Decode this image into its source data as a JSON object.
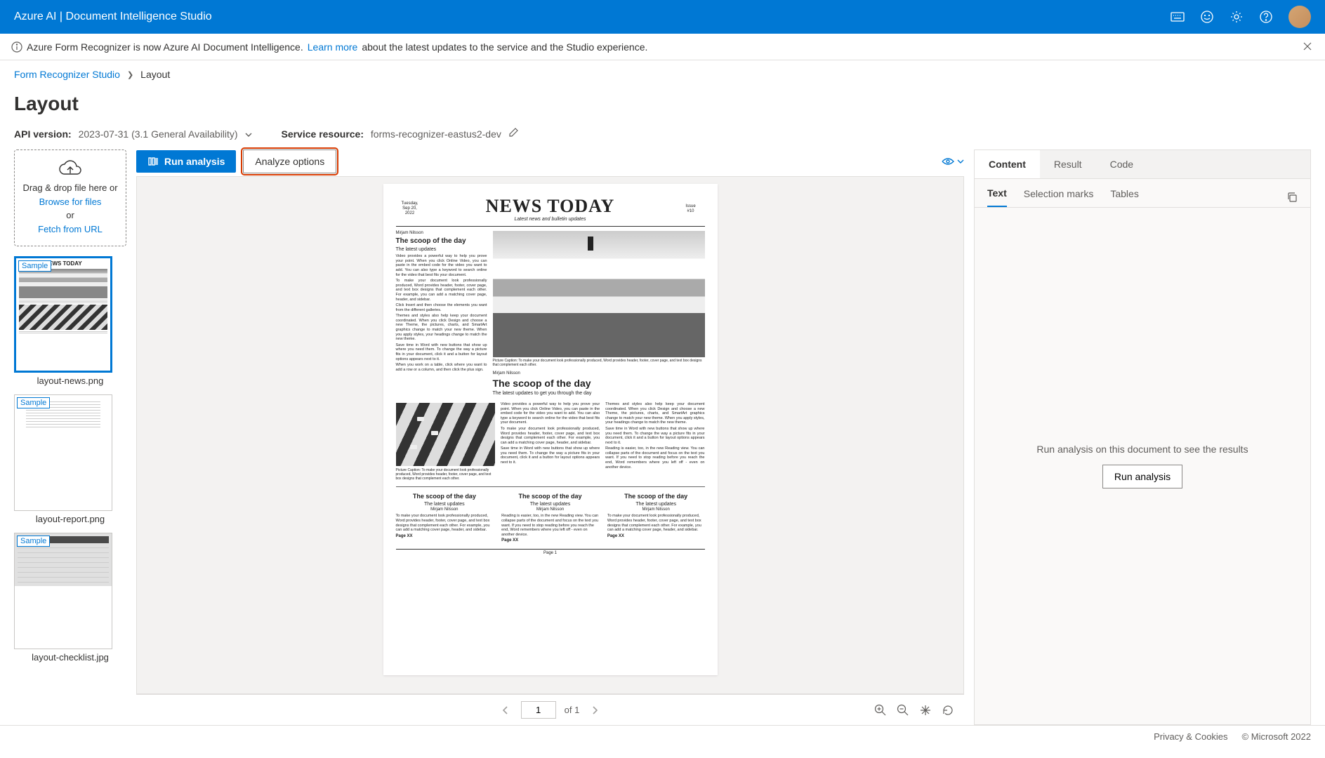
{
  "header": {
    "app_title": "Azure AI | Document Intelligence Studio"
  },
  "banner": {
    "prefix": "Azure Form Recognizer is now Azure AI Document Intelligence. ",
    "link": "Learn more",
    "suffix": " about the latest updates to the service and the Studio experience."
  },
  "breadcrumb": {
    "parent": "Form Recognizer Studio",
    "current": "Layout"
  },
  "page": {
    "title": "Layout"
  },
  "meta": {
    "api_version_label": "API version:",
    "api_version_value": "2023-07-31 (3.1 General Availability)",
    "service_resource_label": "Service resource:",
    "service_resource_value": "forms-recognizer-eastus2-dev"
  },
  "dropzone": {
    "line1": "Drag & drop file here or",
    "browse": "Browse for files",
    "or": "or",
    "fetch": "Fetch from URL"
  },
  "thumbnails": [
    {
      "badge": "Sample",
      "label": "layout-news.png",
      "selected": true
    },
    {
      "badge": "Sample",
      "label": "layout-report.png",
      "selected": false
    },
    {
      "badge": "Sample",
      "label": "layout-checklist.jpg",
      "selected": false
    }
  ],
  "toolbar": {
    "run_analysis": "Run analysis",
    "analyze_options": "Analyze options"
  },
  "pager": {
    "current": "1",
    "of_label": "of 1"
  },
  "right_panel": {
    "top_tabs": [
      "Content",
      "Result",
      "Code"
    ],
    "sub_tabs": [
      "Text",
      "Selection marks",
      "Tables"
    ],
    "empty_message": "Run analysis on this document to see the results",
    "run_button": "Run analysis"
  },
  "footer": {
    "privacy": "Privacy & Cookies",
    "copyright": "© Microsoft 2022"
  },
  "newspaper": {
    "date_l1": "Tuesday,",
    "date_l2": "Sep 20,",
    "date_l3": "2022",
    "title": "NEWS TODAY",
    "subtitle": "Latest news and bulletin updates",
    "issue_l1": "Issue",
    "issue_l2": "#10",
    "author": "Mirjam Nilsson",
    "scoop_heading": "The scoop of the day",
    "latest_short": "The latest updates",
    "latest_long": "The latest updates to get you through the day",
    "para_video": "Video provides a powerful way to help you prove your point. When you click Online Video, you can paste in the embed code for the video you want to add. You can also type a keyword to search online for the video that best fits your document.",
    "para_look": "To make your document look professionally produced, Word provides header, footer, cover page, and text box designs that complement each other. For example, you can add a matching cover page, header, and sidebar.",
    "para_insert": "Click Insert and then choose the elements you want from the different galleries.",
    "para_themes": "Themes and styles also help keep your document coordinated. When you click Design and choose a new Theme, the pictures, charts, and SmartArt graphics change to match your new theme. When you apply styles, your headings change to match the new theme.",
    "para_save": "Save time in Word with new buttons that show up where you need them. To change the way a picture fits in your document, click it and a button for layout options appears next to it.",
    "para_table": "When you work on a table, click where you want to add a row or a column, and then click the plus sign.",
    "para_reading": "Reading is easier, too, in the new Reading view. You can collapse parts of the document and focus on the text you want. If you need to stop reading before you reach the end, Word remembers where you left off - even on another device.",
    "caption": "Picture Caption: To make your document look professionally produced, Word provides header, footer, cover page, and text box designs that complement each other.",
    "page_x": "Page XX",
    "page_1": "Page 1"
  }
}
